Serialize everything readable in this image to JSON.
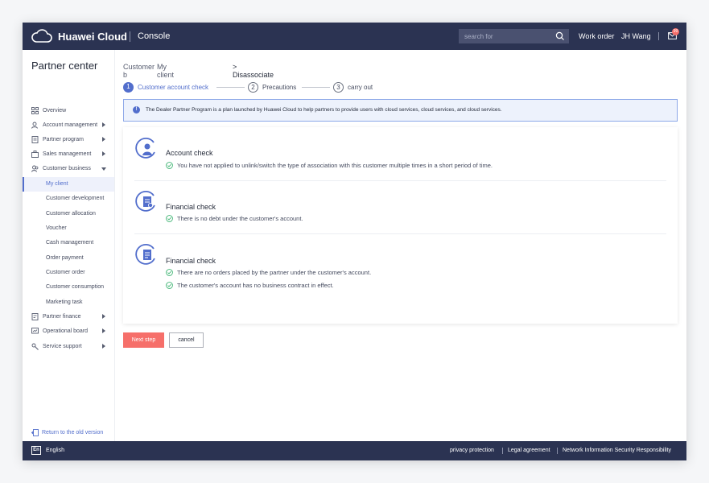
{
  "header": {
    "brand": "Huawei Cloud",
    "console": "Console",
    "search_placeholder": "search for",
    "work_order": "Work order",
    "user": "JH Wang",
    "mail_badge": "99"
  },
  "sidebar": {
    "title": "Partner center",
    "items": [
      {
        "label": "Overview",
        "icon": "grid-icon"
      },
      {
        "label": "Account management",
        "icon": "user-gear-icon"
      },
      {
        "label": "Partner program",
        "icon": "document-icon"
      },
      {
        "label": "Sales management",
        "icon": "briefcase-icon"
      },
      {
        "label": "Customer business",
        "icon": "people-icon"
      }
    ],
    "sub_items": [
      "My client",
      "Customer development",
      "Customer allocation",
      "Voucher",
      "Cash management",
      "Order payment",
      "Customer order",
      "Customer consumption",
      "Marketing task"
    ],
    "items_bottom": [
      {
        "label": "Partner finance",
        "icon": "finance-icon"
      },
      {
        "label": "Operational board",
        "icon": "chart-board-icon"
      },
      {
        "label": "Service support",
        "icon": "wrench-icon"
      }
    ],
    "return_old": "Return to the old version"
  },
  "breadcrumb": {
    "part_a": "Customer b",
    "part_b": "My client",
    "current": "> Disassociate"
  },
  "steps": [
    {
      "num": "1",
      "label": "Customer account check"
    },
    {
      "num": "2",
      "label": "Precautions"
    },
    {
      "num": "3",
      "label": "carry out"
    }
  ],
  "notice": "The Dealer Partner Program is a plan launched by Huawei Cloud to help partners to provide users with cloud services, cloud services, and cloud services.",
  "checks": [
    {
      "title": "Account check",
      "rows": [
        "You have not applied to unlink/switch the type of association with this customer multiple times in a short period of time."
      ]
    },
    {
      "title": "Financial check",
      "rows": [
        "There is no debt under the customer's account."
      ]
    },
    {
      "title": "Financial check",
      "rows": [
        "There are no orders placed by the partner under the customer's account.",
        "The customer's account has no business contract in effect."
      ]
    }
  ],
  "buttons": {
    "next": "Next step",
    "cancel": "cancel"
  },
  "footer": {
    "lang_icon": "En",
    "language": "English",
    "links": [
      "privacy protection",
      "Legal agreement",
      "Network Information Security Responsibility"
    ]
  },
  "colors": {
    "accent": "#526ecc",
    "header": "#2b3352",
    "danger": "#f66f6a",
    "success": "#3cb371"
  }
}
